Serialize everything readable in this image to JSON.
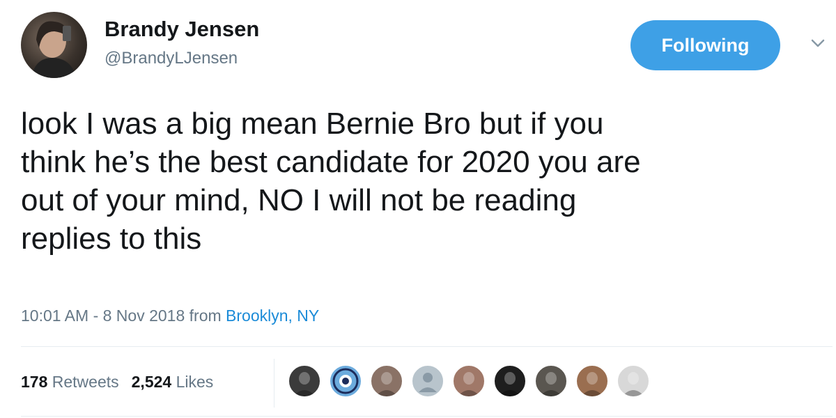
{
  "tweet": {
    "author": {
      "name": "Brandy Jensen",
      "handle": "@BrandyLJensen"
    },
    "follow_button": "Following",
    "text_lines": [
      "look I was a big mean Bernie Bro but if you",
      "think he’s the best candidate for 2020 you are",
      "out of your mind, NO I will not be reading",
      "replies to this"
    ],
    "meta": {
      "time_date": "10:01 AM - 8 Nov 2018",
      "from_label": "from",
      "location": "Brooklyn, NY"
    },
    "stats": {
      "retweets_count": "178",
      "retweets_label": "Retweets",
      "likes_count": "2,524",
      "likes_label": "Likes"
    },
    "likers": [
      {
        "name": "liker-avatar-1",
        "color": "#3b3b3b"
      },
      {
        "name": "liker-avatar-manchester-city-crest",
        "color": "#6cabdd"
      },
      {
        "name": "liker-avatar-3",
        "color": "#8a7266"
      },
      {
        "name": "liker-avatar-default-placeholder",
        "color": "#b8c4cc"
      },
      {
        "name": "liker-avatar-5",
        "color": "#a07868"
      },
      {
        "name": "liker-avatar-6",
        "color": "#1e1e1e"
      },
      {
        "name": "liker-avatar-7",
        "color": "#5a5650"
      },
      {
        "name": "liker-avatar-8",
        "color": "#9a6e50"
      },
      {
        "name": "liker-avatar-9",
        "color": "#d8d8d8"
      }
    ],
    "colors": {
      "accent": "#3ea0e6",
      "link": "#1b8bd8",
      "secondary_text": "#657786"
    }
  }
}
